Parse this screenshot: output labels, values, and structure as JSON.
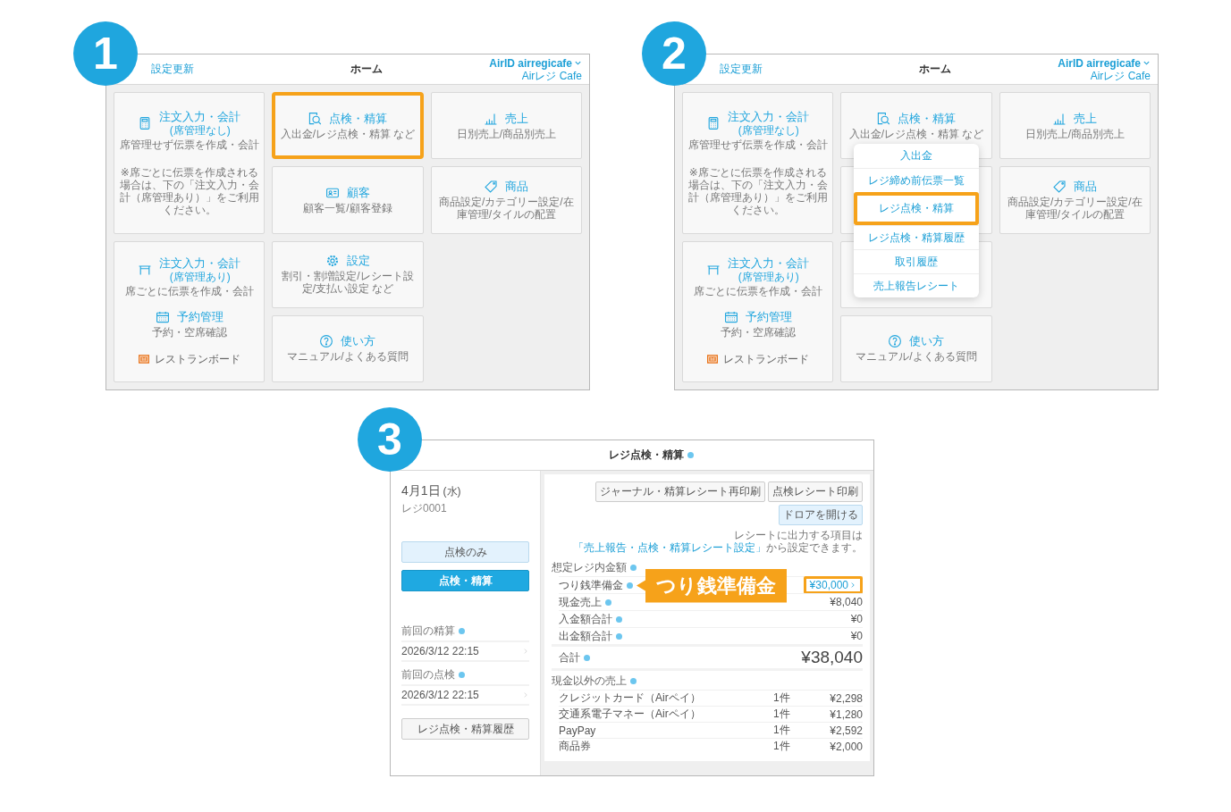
{
  "screens": [
    {
      "kind": "home",
      "badge": "1",
      "header": {
        "link": "設定更新",
        "title": "ホーム",
        "account": "AirID airregicafe",
        "store": "Airレジ Cafe"
      },
      "tiles": [
        {
          "kind": "feature",
          "highlighted": false,
          "sections": [
            {
              "title": "注文入力・会計",
              "subtitle": "(席管理なし)",
              "caption": "席管理せず伝票を作成・会計"
            }
          ],
          "note": "※席ごとに伝票を作成される場合は、下の「注文入力・会計（席管理あり）」をご利用ください。"
        },
        {
          "kind": "feature",
          "highlighted": true,
          "sections": [
            {
              "title": "点検・精算",
              "caption": "入出金/レジ点検・精算 など"
            }
          ]
        },
        {
          "kind": "feature",
          "highlighted": false,
          "sections": [
            {
              "title": "売上",
              "caption": "日別売上/商品別売上"
            }
          ]
        },
        {
          "kind": "feature",
          "highlighted": false,
          "sections": [
            {
              "title": "顧客",
              "caption": "顧客一覧/顧客登録"
            }
          ]
        },
        {
          "kind": "feature",
          "highlighted": false,
          "sections": [
            {
              "title": "商品",
              "caption": "商品設定/カテゴリー設定/在庫管理/タイルの配置"
            }
          ]
        },
        {
          "kind": "feature",
          "highlighted": false,
          "sections": [
            {
              "title": "注文入力・会計",
              "subtitle": "(席管理あり)",
              "caption": "席ごとに伝票を作成・会計"
            },
            {
              "title": "予約管理",
              "caption": "予約・空席確認"
            }
          ],
          "footer": "レストランボード"
        },
        {
          "kind": "feature",
          "highlighted": false,
          "sections": [
            {
              "title": "設定",
              "caption": "割引・割増設定/レシート設定/支払い設定 など"
            }
          ]
        },
        {
          "kind": "feature",
          "highlighted": false,
          "sections": [
            {
              "title": "使い方",
              "caption": "マニュアル/よくある質問"
            }
          ]
        }
      ]
    },
    {
      "kind": "home",
      "badge": "2",
      "header": {
        "link": "設定更新",
        "title": "ホーム",
        "account": "AirID airregicafe",
        "store": "Airレジ Cafe"
      },
      "tiles": [
        {
          "kind": "feature",
          "highlighted": false,
          "sections": [
            {
              "title": "注文入力・会計",
              "subtitle": "(席管理なし)",
              "caption": "席管理せず伝票を作成・会計"
            }
          ],
          "note": "※席ごとに伝票を作成される場合は、下の「注文入力・会計（席管理あり）」をご利用ください。"
        },
        {
          "kind": "feature",
          "highlighted": false,
          "sections": [
            {
              "title": "点検・精算",
              "caption": "入出金/レジ点検・精算 など"
            }
          ]
        },
        {
          "kind": "feature",
          "highlighted": false,
          "sections": [
            {
              "title": "売上",
              "caption": "日別売上/商品別売上"
            }
          ]
        },
        {
          "kind": "covered",
          "highlighted": false
        },
        {
          "kind": "feature",
          "highlighted": false,
          "sections": [
            {
              "title": "商品",
              "caption": "商品設定/カテゴリー設定/在庫管理/タイルの配置"
            }
          ]
        },
        {
          "kind": "feature",
          "highlighted": false,
          "sections": [
            {
              "title": "注文入力・会計",
              "subtitle": "(席管理あり)",
              "caption": "席ごとに伝票を作成・会計"
            },
            {
              "title": "予約管理",
              "caption": "予約・空席確認"
            }
          ],
          "footer": "レストランボード"
        },
        {
          "kind": "covered",
          "highlighted": false
        },
        {
          "kind": "feature",
          "highlighted": false,
          "sections": [
            {
              "title": "使い方",
              "caption": "マニュアル/よくある質問"
            }
          ]
        }
      ],
      "menu": {
        "items": [
          {
            "label": "入出金",
            "highlighted": false
          },
          {
            "label": "レジ締め前伝票一覧",
            "highlighted": false
          },
          {
            "label": "レジ点検・精算",
            "highlighted": true
          },
          {
            "label": "レジ点検・精算履歴",
            "highlighted": false
          },
          {
            "label": "取引履歴",
            "highlighted": false
          },
          {
            "label": "売上報告レシート",
            "highlighted": false
          }
        ]
      }
    },
    {
      "kind": "register",
      "badge": "3",
      "header": {
        "title": "レジ点検・精算"
      },
      "sidebar": {
        "date": "4月1日",
        "weekday": "(水)",
        "register": "レジ0001",
        "buttons": [
          {
            "kind": "secondary",
            "label": "点検のみ"
          },
          {
            "kind": "primary",
            "label": "点検・精算"
          }
        ],
        "history": [
          {
            "label": "前回の精算",
            "value": "2026/3/12 22:15"
          },
          {
            "label": "前回の点検",
            "value": "2026/3/12 22:15"
          }
        ],
        "history_button": "レジ点検・精算履歴"
      },
      "panel": {
        "actions": [
          {
            "kind": "default",
            "label": "ジャーナル・精算レシート再印刷"
          },
          {
            "kind": "default",
            "label": "点検レシート印刷"
          },
          {
            "kind": "accent",
            "label": "ドロアを開ける"
          }
        ],
        "note": {
          "before": "レシートに出力する項目は",
          "link": "「売上報告・点検・精算レシート設定」",
          "after": "から設定できます。"
        },
        "expected": {
          "label": "想定レジ内金額",
          "rows": [
            {
              "label": "つり銭準備金",
              "value": "¥30,000",
              "kind": "link",
              "highlighted": true
            },
            {
              "label": "現金売上",
              "value": "¥8,040",
              "kind": "plain",
              "highlighted": false
            },
            {
              "label": "入金額合計",
              "value": "¥0",
              "kind": "plain",
              "highlighted": false
            },
            {
              "label": "出金額合計",
              "value": "¥0",
              "kind": "plain",
              "highlighted": false
            }
          ]
        },
        "total": {
          "label": "合計",
          "value": "¥38,040"
        },
        "non_cash": {
          "label": "現金以外の売上",
          "rows": [
            {
              "label": "クレジットカード（Airペイ）",
              "count": "1件",
              "value": "¥2,298"
            },
            {
              "label": "交通系電子マネー（Airペイ）",
              "count": "1件",
              "value": "¥1,280"
            },
            {
              "label": "PayPay",
              "count": "1件",
              "value": "¥2,592"
            },
            {
              "label": "商品券",
              "count": "1件",
              "value": "¥2,000"
            }
          ]
        }
      },
      "callout": {
        "label": "つり銭準備金"
      }
    }
  ]
}
